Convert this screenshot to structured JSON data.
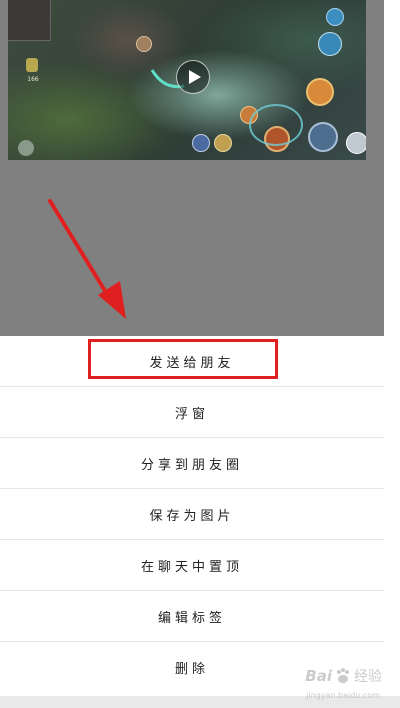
{
  "video": {
    "coin_count": "166"
  },
  "action_sheet": {
    "items": [
      {
        "label": "发送给朋友"
      },
      {
        "label": "浮窗"
      },
      {
        "label": "分享到朋友圈"
      },
      {
        "label": "保存为图片"
      },
      {
        "label": "在聊天中置顶"
      },
      {
        "label": "编辑标签"
      },
      {
        "label": "删除"
      }
    ]
  },
  "watermark": {
    "brand": "Bai",
    "brand_suffix": "经验",
    "url": "jingyan.baidu.com"
  },
  "colors": {
    "highlight": "#e02020",
    "arrow": "#e02020",
    "backdrop": "#808080"
  }
}
